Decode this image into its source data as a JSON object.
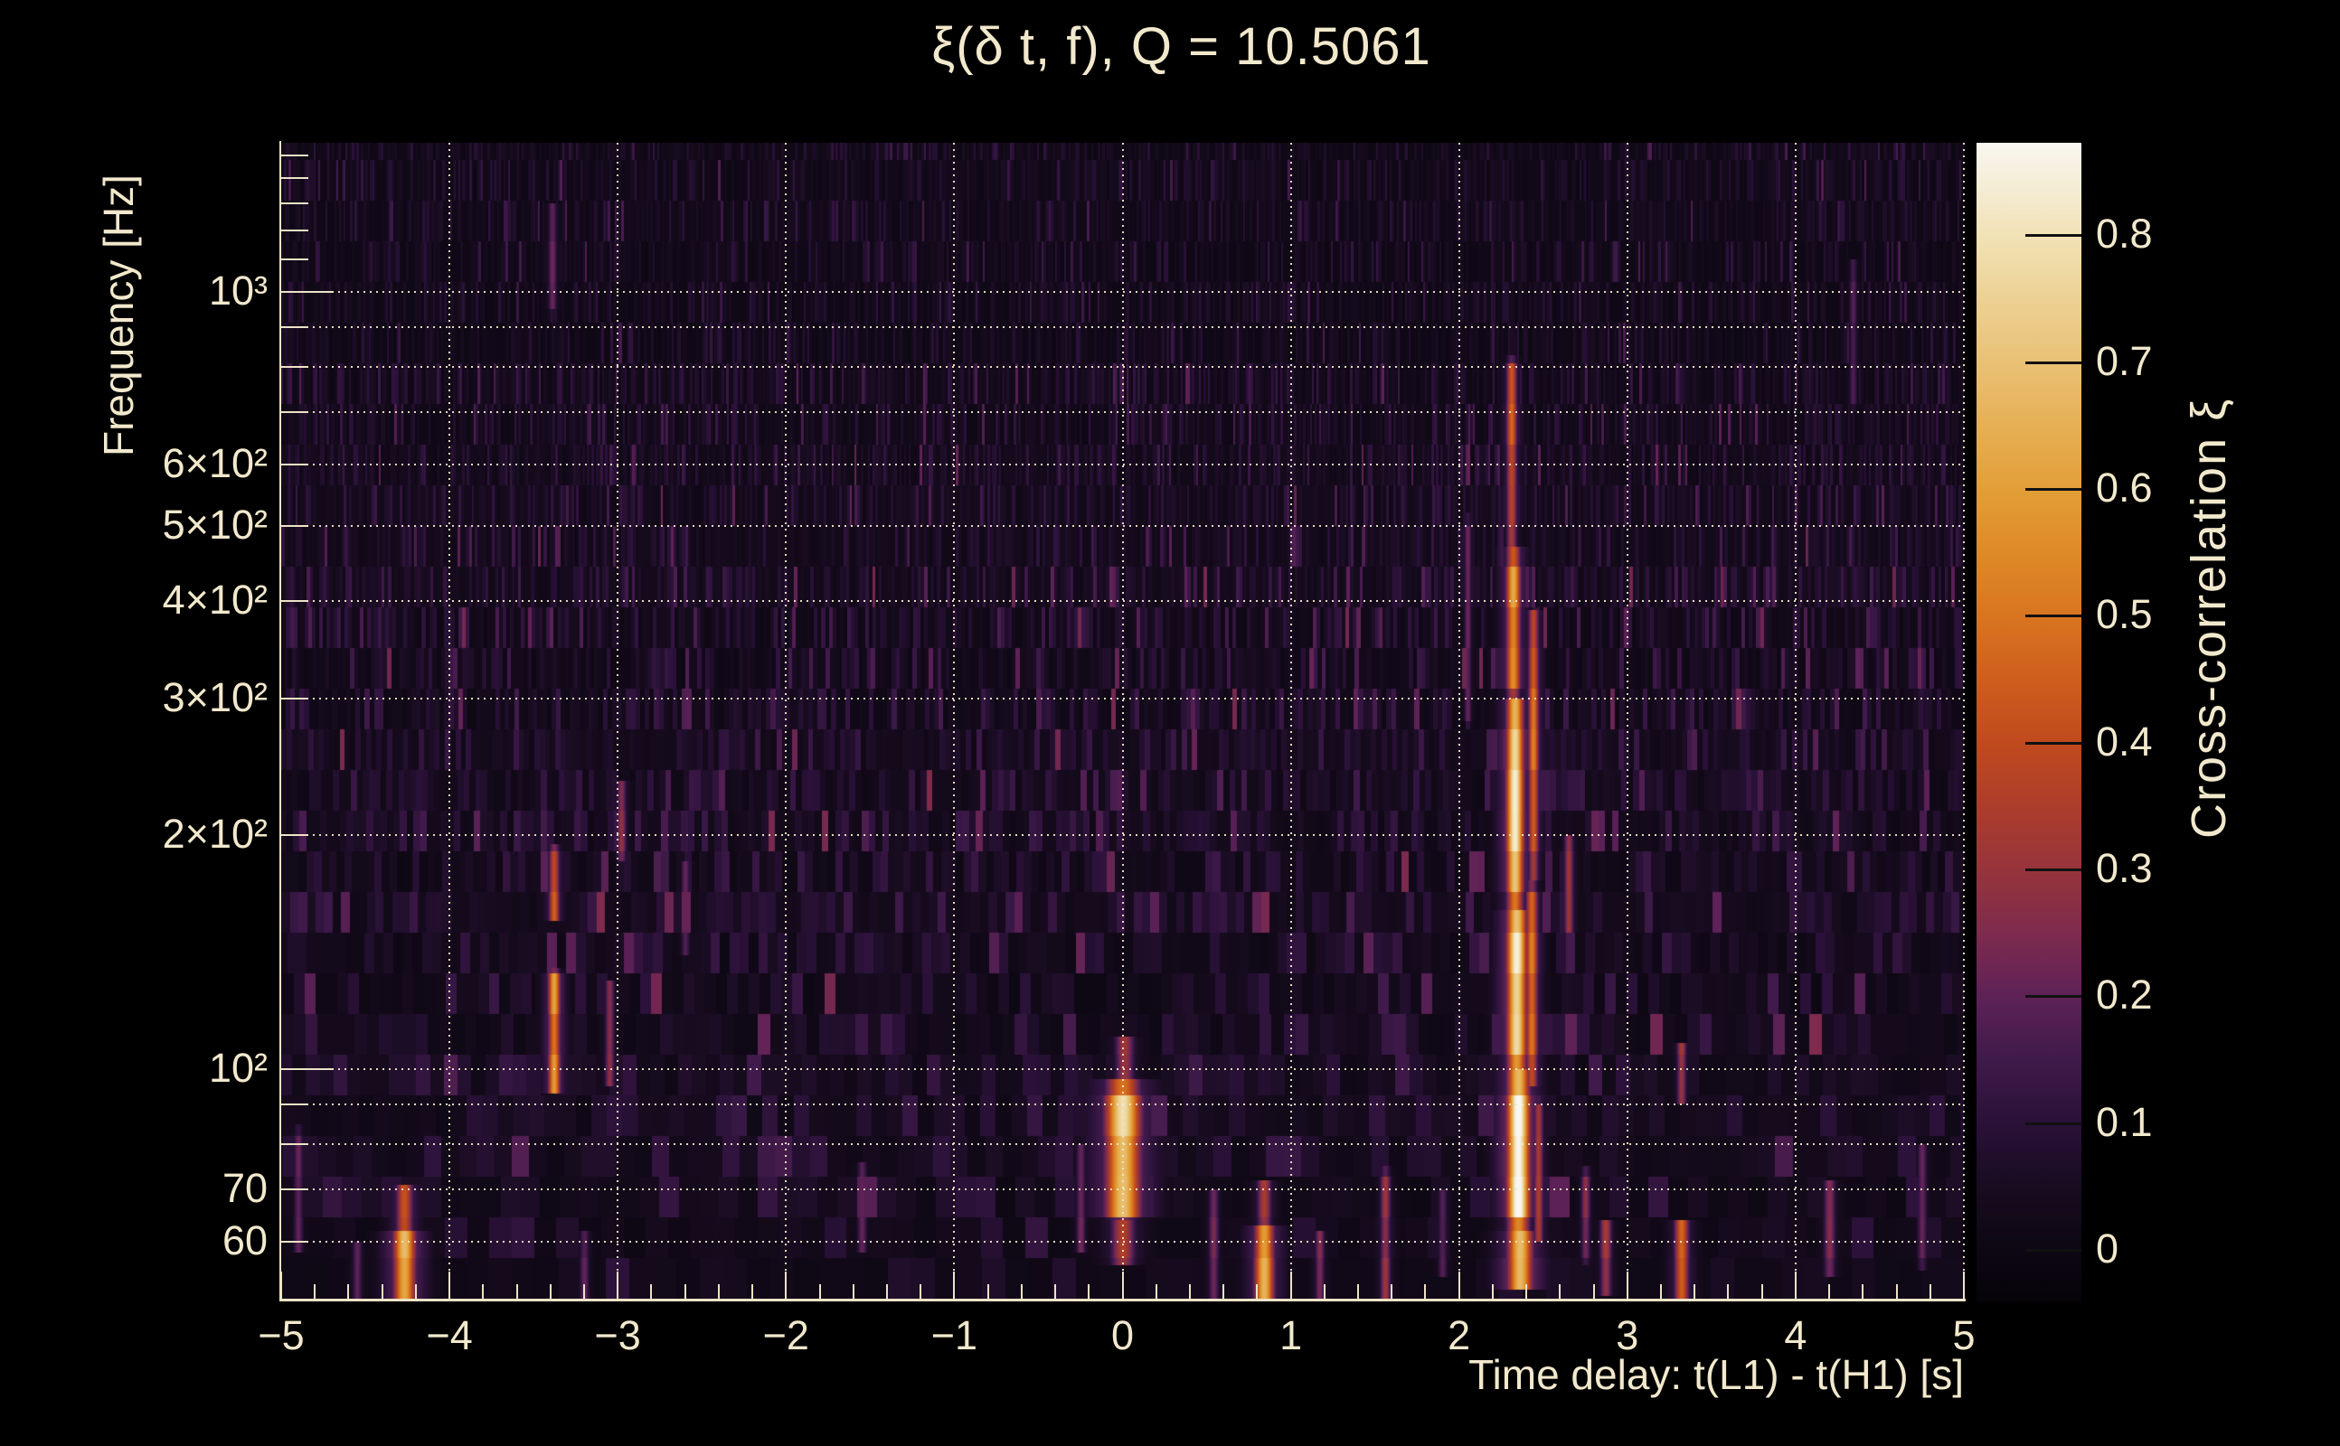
{
  "figure": {
    "background": "#000000",
    "text_color": "#F2E8CC",
    "grid_color": "#EFE5C8",
    "title": "ξ(δ t, f), Q = 10.5061"
  },
  "chart_data": {
    "type": "heatmap",
    "title": "ξ(δ t, f), Q = 10.5061",
    "xlabel": "Time delay: t(L1) - t(H1) [s]",
    "ylabel": "Frequency [Hz]",
    "x_range": [
      -5,
      5
    ],
    "x_minor_step": 0.2,
    "y_scale": "log",
    "y_range_hz": [
      50.7,
      1556
    ],
    "grid": "dotted cream, horizontal at log decades, vertical at integer time delays",
    "x_ticks": [
      {
        "t": -5,
        "label": "−5"
      },
      {
        "t": -4,
        "label": "−4"
      },
      {
        "t": -3,
        "label": "−3"
      },
      {
        "t": -2,
        "label": "−2"
      },
      {
        "t": -1,
        "label": "−1"
      },
      {
        "t": 0,
        "label": "0"
      },
      {
        "t": 1,
        "label": "1"
      },
      {
        "t": 2,
        "label": "2"
      },
      {
        "t": 3,
        "label": "3"
      },
      {
        "t": 4,
        "label": "4"
      },
      {
        "t": 5,
        "label": "5"
      }
    ],
    "y_ticks": [
      {
        "f": 1000,
        "label": "10³",
        "major": true
      },
      {
        "f": 600,
        "label": "6×10²"
      },
      {
        "f": 500,
        "label": "5×10²"
      },
      {
        "f": 400,
        "label": "4×10²"
      },
      {
        "f": 300,
        "label": "3×10²"
      },
      {
        "f": 200,
        "label": "2×10²"
      },
      {
        "f": 100,
        "label": "10²",
        "major": true
      },
      {
        "f": 70,
        "label": "70"
      },
      {
        "f": 60,
        "label": "60"
      }
    ],
    "y_gridlines_hz": [
      60,
      70,
      80,
      90,
      100,
      200,
      300,
      400,
      500,
      600,
      700,
      800,
      900,
      1000
    ],
    "y_minor_ticks_hz": [
      60,
      70,
      80,
      90,
      200,
      300,
      400,
      500,
      600,
      700,
      800,
      900,
      1100,
      1200,
      1300,
      1400,
      1500
    ],
    "colorbar": {
      "label": "Cross-correlation ξ",
      "min": -0.042,
      "max": 0.873,
      "ticks": [
        {
          "v": 0.0,
          "label": "0"
        },
        {
          "v": 0.1,
          "label": "0.1"
        },
        {
          "v": 0.2,
          "label": "0.2"
        },
        {
          "v": 0.3,
          "label": "0.3"
        },
        {
          "v": 0.4,
          "label": "0.4"
        },
        {
          "v": 0.5,
          "label": "0.5"
        },
        {
          "v": 0.6,
          "label": "0.6"
        },
        {
          "v": 0.7,
          "label": "0.7"
        },
        {
          "v": 0.8,
          "label": "0.8"
        }
      ],
      "stops": [
        [
          -0.042,
          5,
          3,
          8
        ],
        [
          0.0,
          13,
          7,
          19
        ],
        [
          0.05,
          24,
          12,
          32
        ],
        [
          0.1,
          42,
          17,
          56
        ],
        [
          0.15,
          63,
          26,
          74
        ],
        [
          0.2,
          94,
          34,
          87
        ],
        [
          0.25,
          126,
          43,
          77
        ],
        [
          0.3,
          151,
          52,
          59
        ],
        [
          0.35,
          172,
          61,
          43
        ],
        [
          0.4,
          192,
          74,
          30
        ],
        [
          0.45,
          206,
          94,
          29
        ],
        [
          0.5,
          216,
          117,
          32
        ],
        [
          0.55,
          222,
          138,
          40
        ],
        [
          0.6,
          227,
          158,
          56
        ],
        [
          0.65,
          230,
          176,
          85
        ],
        [
          0.7,
          233,
          193,
          117
        ],
        [
          0.75,
          237,
          209,
          148
        ],
        [
          0.8,
          241,
          226,
          182
        ],
        [
          0.873,
          248,
          246,
          240
        ]
      ]
    },
    "features": [
      {
        "t": 2.36,
        "sw": 0.05,
        "f0": 52,
        "f1": 62,
        "v": 0.72
      },
      {
        "t": 2.35,
        "sw": 0.045,
        "f0": 62,
        "f1": 100,
        "v": 0.82
      },
      {
        "t": 2.34,
        "sw": 0.04,
        "f0": 100,
        "f1": 160,
        "v": 0.85
      },
      {
        "t": 2.33,
        "sw": 0.035,
        "f0": 160,
        "f1": 300,
        "v": 0.78
      },
      {
        "t": 2.32,
        "sw": 0.03,
        "f0": 300,
        "f1": 470,
        "v": 0.6
      },
      {
        "t": 2.31,
        "sw": 0.022,
        "f0": 470,
        "f1": 830,
        "v": 0.42
      },
      {
        "t": 2.43,
        "sw": 0.025,
        "f0": 95,
        "f1": 175,
        "v": 0.5
      },
      {
        "t": 2.44,
        "sw": 0.022,
        "f0": 175,
        "f1": 390,
        "v": 0.48
      },
      {
        "t": 2.47,
        "sw": 0.02,
        "f0": 60,
        "f1": 90,
        "v": 0.35
      },
      {
        "t": 0.0,
        "sw": 0.07,
        "f0": 64,
        "f1": 97,
        "v": 0.72
      },
      {
        "t": 0.0,
        "sw": 0.05,
        "f0": 56,
        "f1": 64,
        "v": 0.35
      },
      {
        "t": 0.01,
        "sw": 0.04,
        "f0": 97,
        "f1": 110,
        "v": 0.3
      },
      {
        "t": -4.27,
        "sw": 0.045,
        "f0": 50,
        "f1": 62,
        "v": 0.68
      },
      {
        "t": -4.27,
        "sw": 0.035,
        "f0": 62,
        "f1": 71,
        "v": 0.45
      },
      {
        "t": 0.84,
        "sw": 0.04,
        "f0": 50,
        "f1": 63,
        "v": 0.62
      },
      {
        "t": 0.84,
        "sw": 0.03,
        "f0": 63,
        "f1": 72,
        "v": 0.32
      },
      {
        "t": -3.38,
        "sw": 0.025,
        "f0": 93,
        "f1": 135,
        "v": 0.55
      },
      {
        "t": -3.38,
        "sw": 0.022,
        "f0": 155,
        "f1": 195,
        "v": 0.42
      },
      {
        "t": -3.39,
        "sw": 0.018,
        "f0": 950,
        "f1": 1300,
        "v": 0.22
      },
      {
        "t": -3.05,
        "sw": 0.02,
        "f0": 95,
        "f1": 130,
        "v": 0.25
      },
      {
        "t": -2.98,
        "sw": 0.02,
        "f0": 185,
        "f1": 235,
        "v": 0.28
      },
      {
        "t": 3.32,
        "sw": 0.03,
        "f0": 50,
        "f1": 64,
        "v": 0.42
      },
      {
        "t": 3.32,
        "sw": 0.02,
        "f0": 90,
        "f1": 108,
        "v": 0.3
      },
      {
        "t": 2.87,
        "sw": 0.025,
        "f0": 51,
        "f1": 64,
        "v": 0.3
      },
      {
        "t": 2.75,
        "sw": 0.02,
        "f0": 56,
        "f1": 75,
        "v": 0.25
      },
      {
        "t": 2.65,
        "sw": 0.02,
        "f0": 150,
        "f1": 200,
        "v": 0.3
      },
      {
        "t": 2.05,
        "sw": 0.015,
        "f0": 280,
        "f1": 520,
        "v": 0.22
      },
      {
        "t": 1.56,
        "sw": 0.022,
        "f0": 50,
        "f1": 75,
        "v": 0.3
      },
      {
        "t": 1.17,
        "sw": 0.02,
        "f0": 50,
        "f1": 62,
        "v": 0.26
      },
      {
        "t": 0.54,
        "sw": 0.022,
        "f0": 50,
        "f1": 70,
        "v": 0.24
      },
      {
        "t": -0.25,
        "sw": 0.02,
        "f0": 58,
        "f1": 80,
        "v": 0.22
      },
      {
        "t": -1.55,
        "sw": 0.02,
        "f0": 58,
        "f1": 76,
        "v": 0.2
      },
      {
        "t": 1.9,
        "sw": 0.02,
        "f0": 54,
        "f1": 70,
        "v": 0.2
      },
      {
        "t": 4.2,
        "sw": 0.025,
        "f0": 54,
        "f1": 72,
        "v": 0.24
      },
      {
        "t": 4.34,
        "sw": 0.016,
        "f0": 700,
        "f1": 1100,
        "v": 0.18
      },
      {
        "t": 4.75,
        "sw": 0.02,
        "f0": 55,
        "f1": 80,
        "v": 0.2
      },
      {
        "t": -4.9,
        "sw": 0.02,
        "f0": 58,
        "f1": 85,
        "v": 0.2
      },
      {
        "t": -4.55,
        "sw": 0.02,
        "f0": 50,
        "f1": 60,
        "v": 0.22
      },
      {
        "t": -3.2,
        "sw": 0.02,
        "f0": 50,
        "f1": 62,
        "v": 0.2
      },
      {
        "t": -2.6,
        "sw": 0.018,
        "f0": 140,
        "f1": 185,
        "v": 0.2
      }
    ]
  }
}
